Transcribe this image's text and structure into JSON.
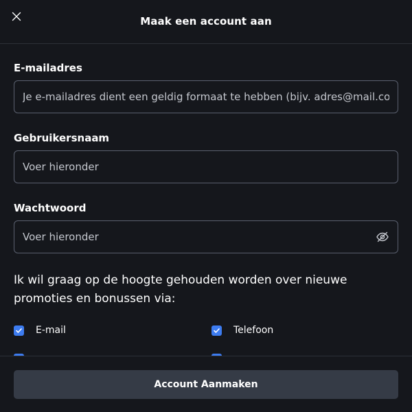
{
  "header": {
    "title": "Maak een account aan",
    "close_icon": "close-icon"
  },
  "form": {
    "email": {
      "label": "E-mailadres",
      "placeholder": "Je e-mailadres dient een geldig formaat te hebben (bijv. adres@mail.com)",
      "value": ""
    },
    "username": {
      "label": "Gebruikersnaam",
      "placeholder": "Voer hieronder",
      "value": ""
    },
    "password": {
      "label": "Wachtwoord",
      "placeholder": "Voer hieronder",
      "value": "",
      "toggle_icon": "eye-off-icon"
    }
  },
  "promotions": {
    "text": "Ik wil graag op de hoogte gehouden worden over nieuwe promoties en bonussen via:",
    "options": [
      {
        "label": "E-mail",
        "checked": true
      },
      {
        "label": "Telefoon",
        "checked": true
      },
      {
        "label": "",
        "checked": true
      },
      {
        "label": "",
        "checked": true
      }
    ]
  },
  "footer": {
    "submit_label": "Account Aanmaken"
  },
  "colors": {
    "background": "#15171c",
    "border": "#5b6170",
    "divider": "#2c3038",
    "checkbox": "#3d7cf0",
    "button": "#353b46"
  }
}
